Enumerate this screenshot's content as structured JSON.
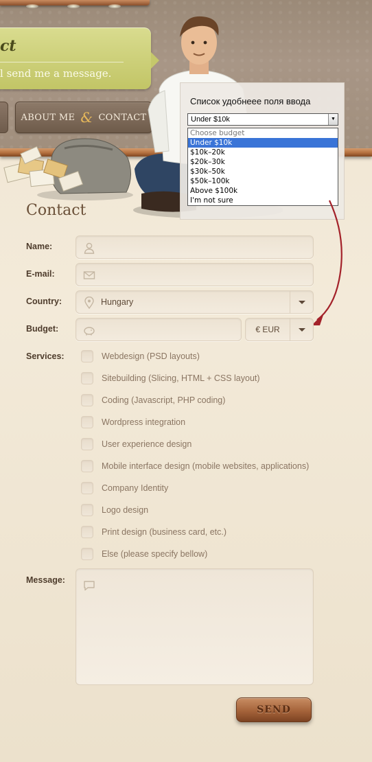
{
  "header": {
    "banner_title": "ct",
    "banner_text": "l send me a message.",
    "nav": {
      "about": "ABOUT ME",
      "amp": "&",
      "contact": "CONTACT"
    }
  },
  "annotation": {
    "caption": "Список удобнеее поля ввода",
    "selected_value": "Under $10k",
    "options": [
      "Choose budget",
      "Under $10k",
      "$10k–20k",
      "$20k–30k",
      "$30k–50k",
      "$50k–100k",
      "Above $100k",
      "I'm not sure"
    ],
    "highlighted_option": "Under $10k",
    "arrow_color": "#a3222a"
  },
  "form": {
    "title": "Contact",
    "labels": {
      "name": "Name:",
      "email": "E-mail:",
      "country": "Country:",
      "budget": "Budget:",
      "services": "Services:",
      "message": "Message:"
    },
    "name_value": "",
    "email_value": "",
    "country_value": "Hungary",
    "budget_value": "",
    "currency_value": "€ EUR",
    "services": [
      "Webdesign (PSD layouts)",
      "Sitebuilding (Slicing, HTML + CSS layout)",
      "Coding (Javascript, PHP coding)",
      "Wordpress integration",
      "User experience design",
      "Mobile interface design (mobile websites, applications)",
      "Company Identity",
      "Logo design",
      "Print design (business card, etc.)",
      "Else (please specify bellow)"
    ],
    "message_value": "",
    "send_label": "SEND"
  },
  "icons": {
    "name": "user-icon",
    "email": "envelope-icon",
    "country": "location-pin-icon",
    "budget": "piggy-bank-icon",
    "message": "speech-bubble-icon"
  },
  "colors": {
    "accent_green": "#c9cc72",
    "wood_brown": "#a5633a",
    "page_bg": "#f1e6d3",
    "highlight_blue": "#3a74d7"
  }
}
